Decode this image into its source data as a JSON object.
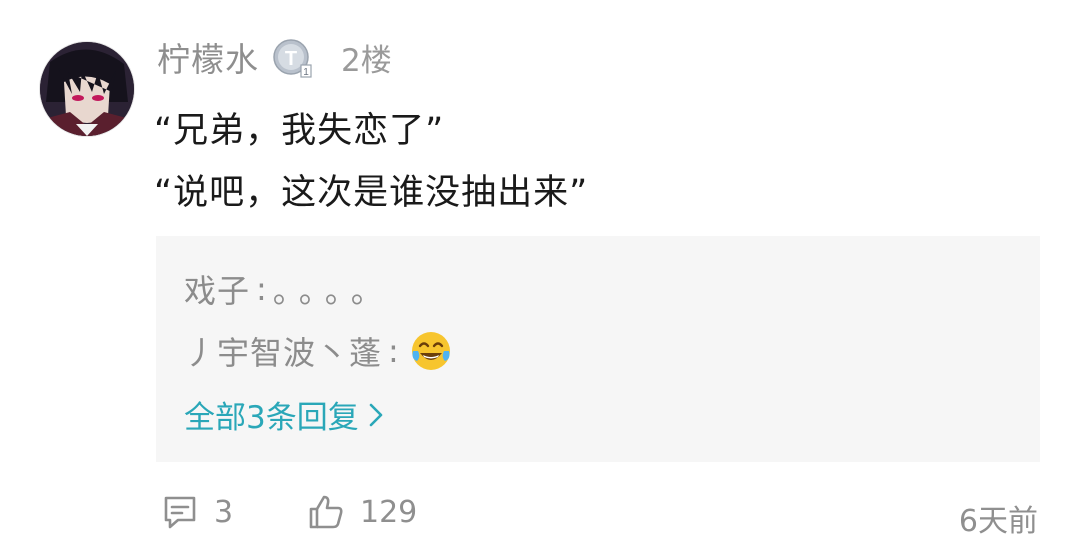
{
  "post": {
    "username": "柠檬水",
    "badge_letter": "T",
    "floor": "2楼",
    "lines": [
      "“兄弟，我失恋了”",
      "“说吧，这次是谁没抽出来”"
    ]
  },
  "replies": {
    "items": [
      {
        "name": "戏子",
        "separator": ":",
        "text": "。。。。"
      },
      {
        "name": "丿宇智波丶蓬",
        "separator": ":",
        "emoji": "tears-of-joy-emoji"
      }
    ],
    "view_all_label": "全部3条回复",
    "link_color": "#2aa7b8"
  },
  "footer": {
    "comment_count": "3",
    "like_count": "129",
    "timestamp": "6天前"
  }
}
